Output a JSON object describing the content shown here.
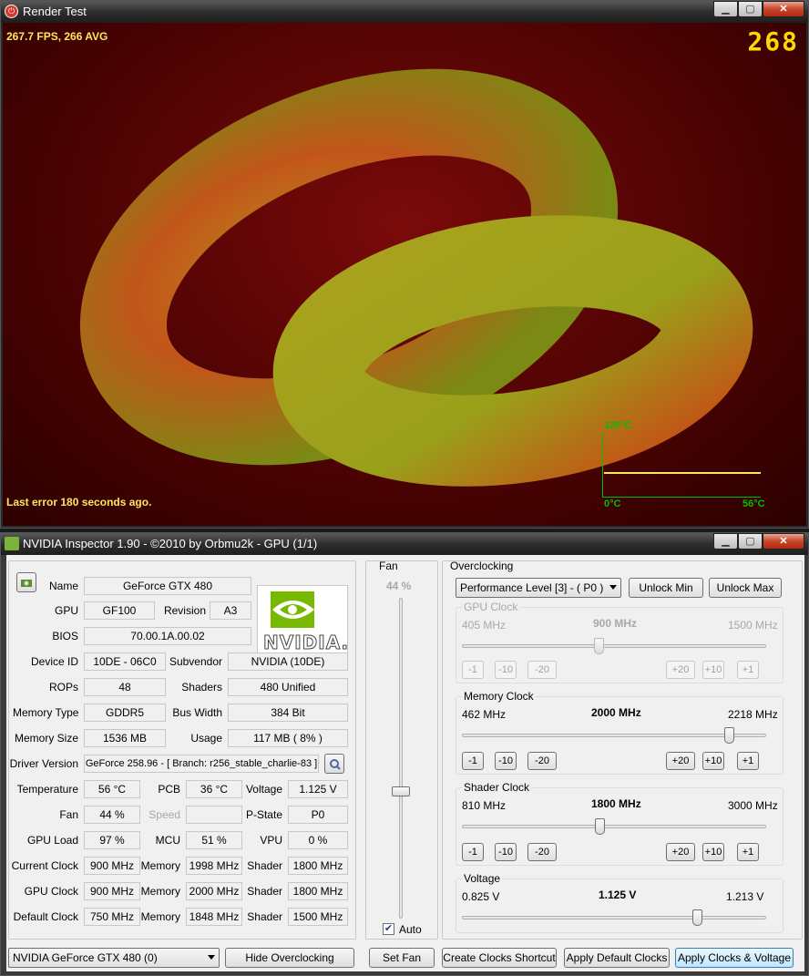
{
  "render": {
    "title": "Render Test",
    "fps_text": "267.7 FPS, 266 AVG",
    "fps_counter": "268",
    "last_error": "Last error 180 seconds ago.",
    "graph": {
      "max_label": "120°C",
      "min_label": "0°C",
      "current_label": "56°C",
      "current_value": 56,
      "max_value": 120
    }
  },
  "inspector": {
    "title": "NVIDIA Inspector 1.90 - ©2010 by Orbmu2k - GPU (1/1)",
    "info": {
      "name_label": "Name",
      "name": "GeForce GTX 480",
      "gpu_label": "GPU",
      "gpu": "GF100",
      "revision_label": "Revision",
      "revision": "A3",
      "bios_label": "BIOS",
      "bios": "70.00.1A.00.02",
      "device_id_label": "Device ID",
      "device_id": "10DE - 06C0",
      "subvendor_label": "Subvendor",
      "subvendor": "NVIDIA (10DE)",
      "rops_label": "ROPs",
      "rops": "48",
      "shaders_label": "Shaders",
      "shaders": "480 Unified",
      "memory_type_label": "Memory Type",
      "memory_type": "GDDR5",
      "bus_width_label": "Bus Width",
      "bus_width": "384 Bit",
      "memory_size_label": "Memory Size",
      "memory_size": "1536 MB",
      "usage_label": "Usage",
      "usage": "117 MB ( 8% )",
      "driver_label": "Driver Version",
      "driver": "GeForce 258.96 - [ Branch: r256_stable_charlie-83 ]",
      "temperature_label": "Temperature",
      "temperature": "56 °C",
      "pcb_label": "PCB",
      "pcb": "36 °C",
      "voltage_label": "Voltage",
      "voltage": "1.125 V",
      "fan_label": "Fan",
      "fan": "44 %",
      "speed_label": "Speed",
      "speed": "",
      "pstate_label": "P-State",
      "pstate": "P0",
      "gpu_load_label": "GPU Load",
      "gpu_load": "97 %",
      "mcu_label": "MCU",
      "mcu": "51 %",
      "vpu_label": "VPU",
      "vpu": "0 %",
      "current_clock_label": "Current Clock",
      "current_clock": "900 MHz",
      "current_memory": "1998 MHz",
      "current_shader": "1800 MHz",
      "gpu_clock_label": "GPU Clock",
      "gpu_clock": "900 MHz",
      "gpu_memory": "2000 MHz",
      "gpu_shader": "1800 MHz",
      "default_clock_label": "Default Clock",
      "default_clock": "750 MHz",
      "default_memory": "1848 MHz",
      "default_shader": "1500 MHz",
      "memory_label": "Memory",
      "shader_label": "Shader",
      "logo_text": "NVIDIA."
    },
    "gpu_select": "NVIDIA GeForce GTX 480 (0)",
    "hide_oc_button": "Hide Overclocking",
    "fan": {
      "title": "Fan",
      "value": "44 %",
      "level": 44,
      "auto_label": "Auto",
      "auto_checked": true,
      "set_button": "Set Fan"
    },
    "overclocking": {
      "title": "Overclocking",
      "perf_level": "Performance Level [3] - ( P0 )",
      "unlock_min": "Unlock Min",
      "unlock_max": "Unlock Max",
      "gpu_clock": {
        "title": "GPU Clock",
        "min": "405 MHz",
        "value": "900 MHz",
        "max": "1500 MHz",
        "level": 0.45
      },
      "memory_clock": {
        "title": "Memory Clock",
        "min": "462 MHz",
        "value": "2000 MHz",
        "max": "2218 MHz",
        "level": 0.876
      },
      "shader_clock": {
        "title": "Shader Clock",
        "min": "810 MHz",
        "value": "1800 MHz",
        "max": "3000 MHz",
        "level": 0.452
      },
      "voltage": {
        "title": "Voltage",
        "min": "0.825 V",
        "value": "1.125 V",
        "max": "1.213 V",
        "level": 0.773
      },
      "step_buttons": {
        "m1": "-1",
        "m10": "-10",
        "m20": "-20",
        "p20": "+20",
        "p10": "+10",
        "p1": "+1"
      }
    },
    "buttons": {
      "create_shortcut": "Create Clocks Shortcut",
      "apply_default": "Apply Default Clocks",
      "apply_clocks": "Apply Clocks & Voltage"
    }
  }
}
